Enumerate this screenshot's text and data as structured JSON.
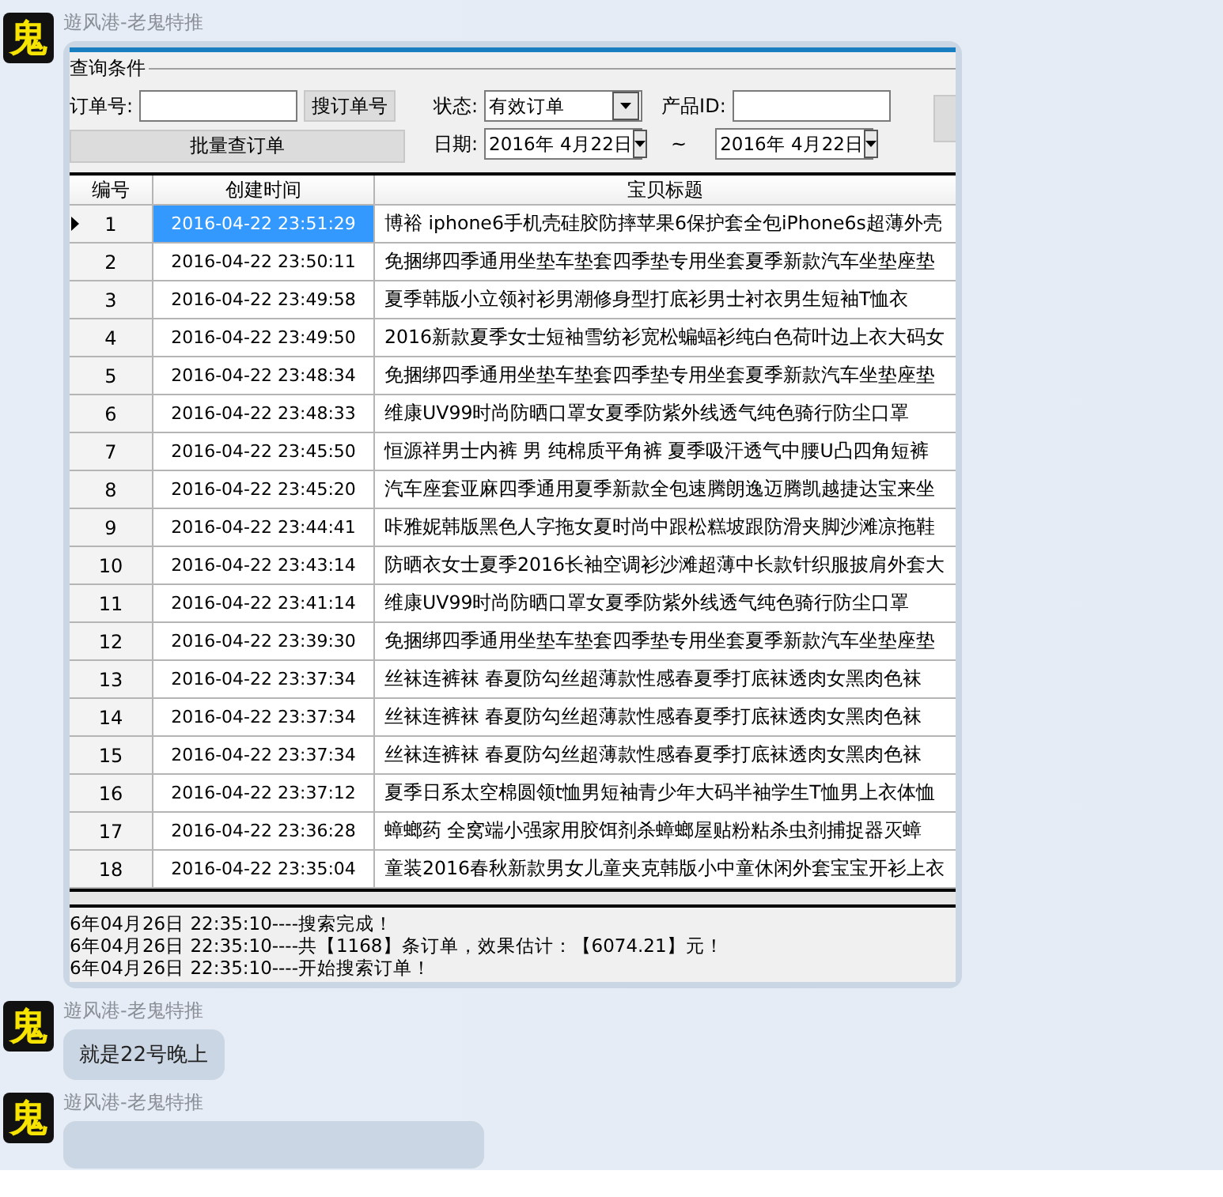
{
  "messages": [
    {
      "sender": "遊风港-老鬼特推",
      "avatar_glyph": "鬼",
      "kind": "screenshot"
    },
    {
      "sender": "遊风港-老鬼特推",
      "avatar_glyph": "鬼",
      "kind": "text",
      "text": "就是22号晚上"
    },
    {
      "sender": "遊风港-老鬼特推",
      "avatar_glyph": "鬼",
      "kind": "cut"
    }
  ],
  "app": {
    "group_title": "查询条件",
    "order_no_label": "订单号:",
    "search_order_button": "搜订单号",
    "batch_button": "批量查订单",
    "status_label": "状态:",
    "status_value": "有效订单",
    "product_id_label": "产品ID:",
    "date_label": "日期:",
    "date_from": "2016年 4月22日",
    "date_sep": "~",
    "date_to": "2016年 4月22日",
    "table": {
      "columns": [
        "编号",
        "创建时间",
        "宝贝标题"
      ],
      "rows": [
        {
          "no": "1",
          "time": "2016-04-22 23:51:29",
          "title": "博裕 iphone6手机壳硅胶防摔苹果6保护套全包iPhone6s超薄外壳",
          "selected": true
        },
        {
          "no": "2",
          "time": "2016-04-22 23:50:11",
          "title": "免捆绑四季通用坐垫车垫套四季垫专用坐套夏季新款汽车坐垫座垫",
          "selected": false
        },
        {
          "no": "3",
          "time": "2016-04-22 23:49:58",
          "title": "夏季韩版小立领衬衫男潮修身型打底衫男士衬衣男生短袖T恤衣",
          "selected": false
        },
        {
          "no": "4",
          "time": "2016-04-22 23:49:50",
          "title": "2016新款夏季女士短袖雪纺衫宽松蝙蝠衫纯白色荷叶边上衣大码女",
          "selected": false
        },
        {
          "no": "5",
          "time": "2016-04-22 23:48:34",
          "title": "免捆绑四季通用坐垫车垫套四季垫专用坐套夏季新款汽车坐垫座垫",
          "selected": false
        },
        {
          "no": "6",
          "time": "2016-04-22 23:48:33",
          "title": "维康UV99时尚防晒口罩女夏季防紫外线透气纯色骑行防尘口罩",
          "selected": false
        },
        {
          "no": "7",
          "time": "2016-04-22 23:45:50",
          "title": "恒源祥男士内裤 男 纯棉质平角裤 夏季吸汗透气中腰U凸四角短裤",
          "selected": false
        },
        {
          "no": "8",
          "time": "2016-04-22 23:45:20",
          "title": "汽车座套亚麻四季通用夏季新款全包速腾朗逸迈腾凯越捷达宝来坐",
          "selected": false
        },
        {
          "no": "9",
          "time": "2016-04-22 23:44:41",
          "title": "咔雅妮韩版黑色人字拖女夏时尚中跟松糕坡跟防滑夹脚沙滩凉拖鞋",
          "selected": false
        },
        {
          "no": "10",
          "time": "2016-04-22 23:43:14",
          "title": "防晒衣女士夏季2016长袖空调衫沙滩超薄中长款针织服披肩外套大",
          "selected": false
        },
        {
          "no": "11",
          "time": "2016-04-22 23:41:14",
          "title": "维康UV99时尚防晒口罩女夏季防紫外线透气纯色骑行防尘口罩",
          "selected": false
        },
        {
          "no": "12",
          "time": "2016-04-22 23:39:30",
          "title": "免捆绑四季通用坐垫车垫套四季垫专用坐套夏季新款汽车坐垫座垫",
          "selected": false
        },
        {
          "no": "13",
          "time": "2016-04-22 23:37:34",
          "title": "丝袜连裤袜 春夏防勾丝超薄款性感春夏季打底袜透肉女黑肉色袜",
          "selected": false
        },
        {
          "no": "14",
          "time": "2016-04-22 23:37:34",
          "title": "丝袜连裤袜 春夏防勾丝超薄款性感春夏季打底袜透肉女黑肉色袜",
          "selected": false
        },
        {
          "no": "15",
          "time": "2016-04-22 23:37:34",
          "title": "丝袜连裤袜 春夏防勾丝超薄款性感春夏季打底袜透肉女黑肉色袜",
          "selected": false
        },
        {
          "no": "16",
          "time": "2016-04-22 23:37:12",
          "title": "夏季日系太空棉圆领t恤男短袖青少年大码半袖学生T恤男上衣体恤",
          "selected": false
        },
        {
          "no": "17",
          "time": "2016-04-22 23:36:28",
          "title": "蟑螂药 全窝端小强家用胶饵剂杀蟑螂屋贴粉粘杀虫剂捕捉器灭蟑",
          "selected": false
        },
        {
          "no": "18",
          "time": "2016-04-22 23:35:04",
          "title": "童装2016春秋新款男女儿童夹克韩版小中童休闲外套宝宝开衫上衣",
          "selected": false
        }
      ]
    },
    "log": [
      "6年04月26日 22:35:10----搜索完成！",
      "6年04月26日 22:35:10----共【1168】条订单，效果估计：【6074.21】元！",
      "6年04月26日 22:35:10----开始搜索订单！"
    ]
  }
}
